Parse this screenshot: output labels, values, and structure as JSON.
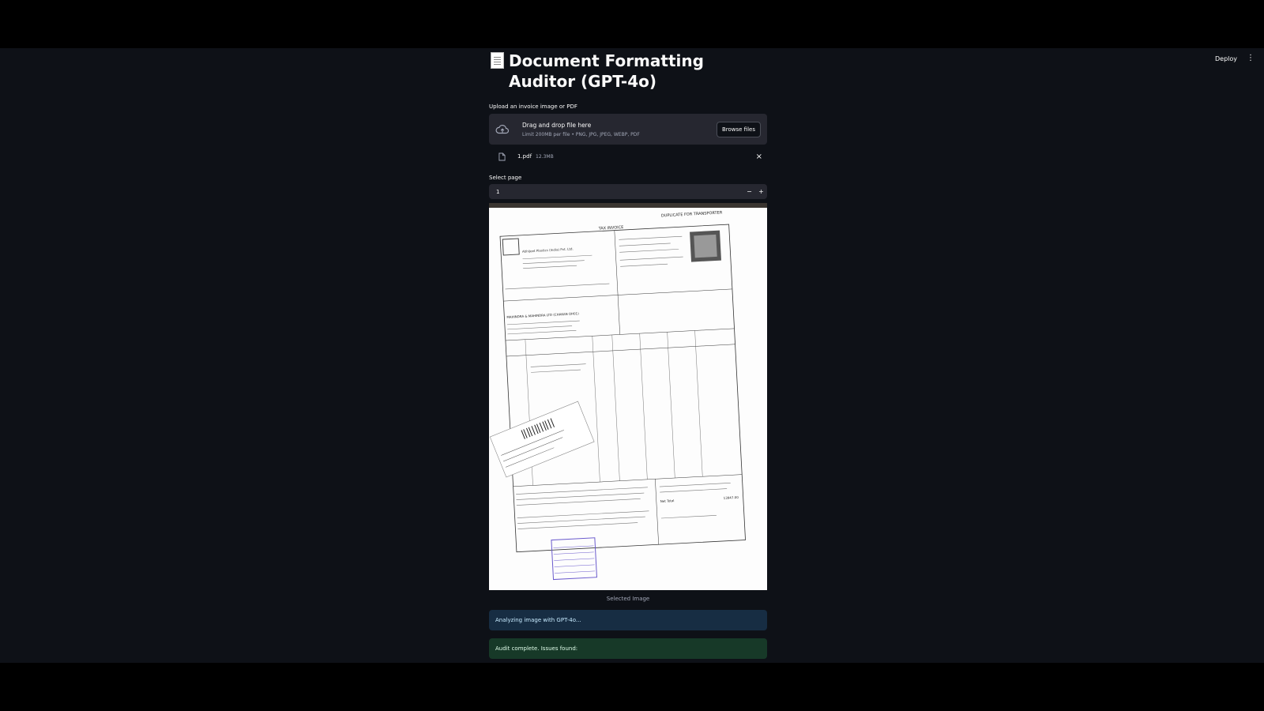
{
  "header": {
    "deploy_label": "Deploy",
    "menu_icon": "kebab-menu-icon"
  },
  "page": {
    "title": "Document Formatting Auditor (GPT-4o)",
    "title_icon": "document-icon"
  },
  "uploader": {
    "label": "Upload an invoice image or PDF",
    "drop_text": "Drag and drop file here",
    "limit_text": "Limit 200MB per file • PNG, JPG, JPEG, WEBP, PDF",
    "browse_label": "Browse files",
    "icon": "cloud-upload-icon"
  },
  "uploaded_file": {
    "name": "1.pdf",
    "size": "12.3MB",
    "icon": "file-icon"
  },
  "page_select": {
    "label": "Select page",
    "value": "1",
    "minus": "−",
    "plus": "+"
  },
  "image": {
    "caption": "Selected Image",
    "document": {
      "heading": "TAX INVOICE",
      "copy_label": "DUPLICATE FOR TRANSPORTER",
      "supplier": "Abhijeet Plastics (India) Pvt. Ltd.",
      "recipient": "MAHINDRA & MAHINDRA LTD (CHAKAN OH01)",
      "net_total_label": "Net Total",
      "net_total_value": "13947.00"
    }
  },
  "status": {
    "info": "Analyzing image with GPT-4o...",
    "success": "Audit complete. Issues found:"
  },
  "colors": {
    "background": "#0e1117",
    "secondary_bg": "#262730",
    "info_bg": "#172d43",
    "success_bg": "#173928"
  }
}
